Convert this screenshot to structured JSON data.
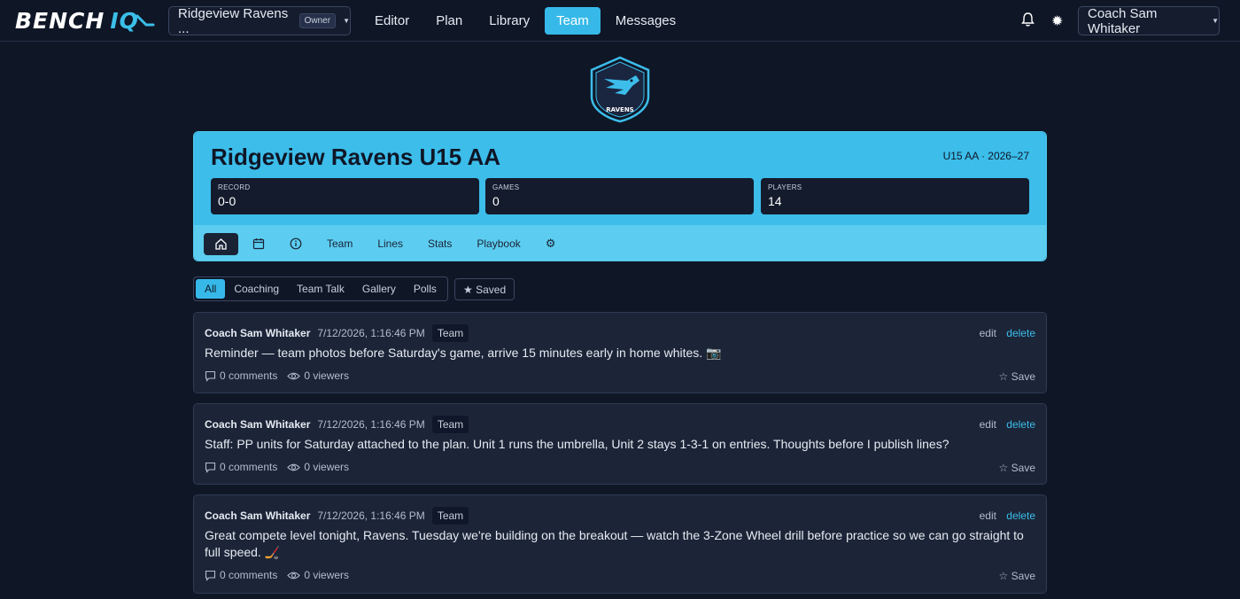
{
  "app": {
    "logo_text": "BENCH",
    "logo_accent": "IQ",
    "team_selector": "Ridgeview Ravens ...",
    "team_role_badge": "Owner",
    "user_menu": "Coach Sam Whitaker",
    "accent_color": "#36b9e8"
  },
  "nav": {
    "items": [
      "Editor",
      "Plan",
      "Library",
      "Team",
      "Messages"
    ],
    "active": "Team"
  },
  "crest": {
    "label": "RAVENS"
  },
  "team": {
    "name": "Ridgeview Ravens U15 AA",
    "season": "U15 AA · 2026–27",
    "stats": [
      {
        "label": "RECORD",
        "value": "0-0"
      },
      {
        "label": "GAMES",
        "value": "0"
      },
      {
        "label": "PLAYERS",
        "value": "14"
      }
    ],
    "tabs": {
      "home_icon": "home-icon",
      "calendar_icon": "calendar-icon",
      "info_icon": "info-icon",
      "team": "Team",
      "lines": "Lines",
      "stats": "Stats",
      "playbook": "Playbook",
      "settings_icon": "gear-icon"
    }
  },
  "filters": {
    "items": [
      "All",
      "Coaching",
      "Team Talk",
      "Gallery",
      "Polls"
    ],
    "active": "All",
    "saved": "★ Saved"
  },
  "posts": [
    {
      "author": "Coach Sam Whitaker",
      "time": "7/12/2026, 1:16:46 PM",
      "tag": "Team",
      "body": "Reminder — team photos before Saturday's game, arrive 15 minutes early in home whites. 📷",
      "comments": "0 comments",
      "viewers": "0 viewers",
      "edit": "edit",
      "delete": "delete",
      "save": "☆ Save"
    },
    {
      "author": "Coach Sam Whitaker",
      "time": "7/12/2026, 1:16:46 PM",
      "tag": "Team",
      "body": "Staff: PP units for Saturday attached to the plan. Unit 1 runs the umbrella, Unit 2 stays 1-3-1 on entries. Thoughts before I publish lines?",
      "comments": "0 comments",
      "viewers": "0 viewers",
      "edit": "edit",
      "delete": "delete",
      "save": "☆ Save"
    },
    {
      "author": "Coach Sam Whitaker",
      "time": "7/12/2026, 1:16:46 PM",
      "tag": "Team",
      "body": "Great compete level tonight, Ravens. Tuesday we're building on the breakout — watch the 3-Zone Wheel drill before practice so we can go straight to full speed. 🏒",
      "comments": "0 comments",
      "viewers": "0 viewers",
      "edit": "edit",
      "delete": "delete",
      "save": "☆ Save"
    }
  ]
}
